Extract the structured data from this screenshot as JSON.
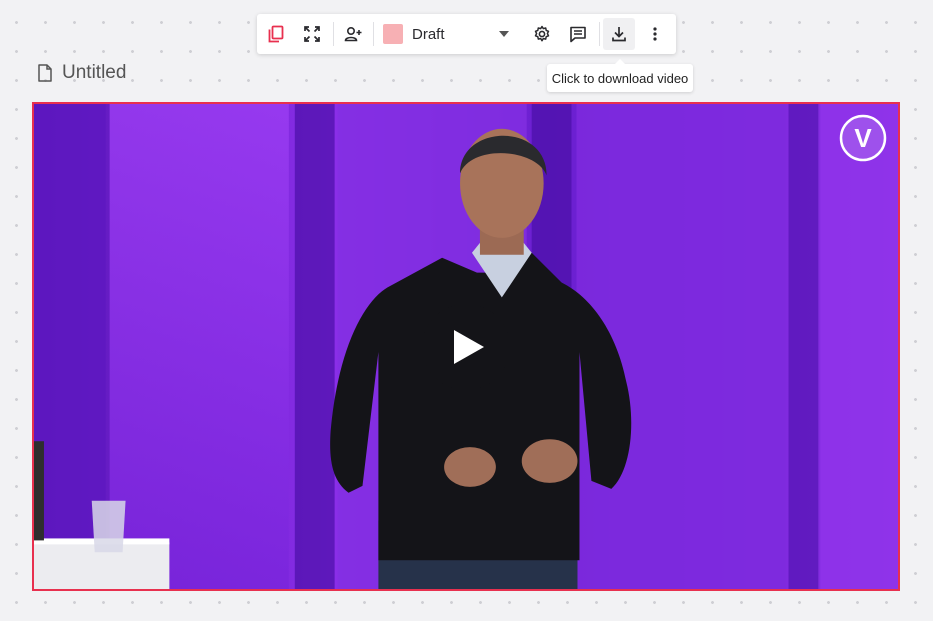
{
  "toolbar": {
    "status_label": "Draft",
    "status_color": "#f7b0b4",
    "accent_color": "#e8304f",
    "icons": [
      "copy-pages-icon",
      "fullscreen-icon",
      "add-person-icon",
      "gear-icon",
      "comment-icon",
      "download-icon",
      "more-vertical-icon"
    ]
  },
  "tooltip": {
    "text": "Click to download video"
  },
  "document": {
    "title": "Untitled"
  },
  "video": {
    "border_color": "#e8304f",
    "logo_letter": "V"
  }
}
